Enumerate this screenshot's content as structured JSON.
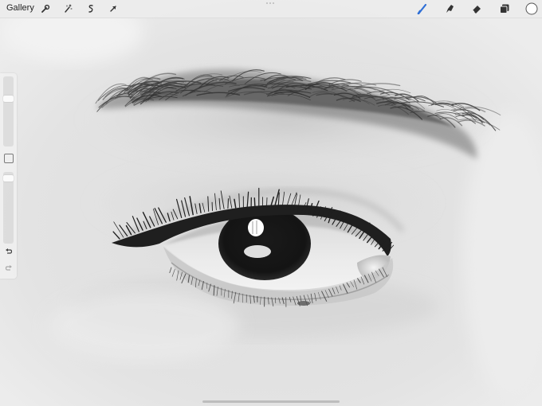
{
  "toolbar": {
    "gallery_label": "Gallery",
    "left_tools": [
      "wrench-icon",
      "magic-wand-icon",
      "selection-icon",
      "transform-arrow-icon"
    ],
    "right_tools": [
      "brush-icon",
      "smudge-icon",
      "eraser-icon",
      "layers-icon",
      "color-swatch"
    ]
  },
  "colors": {
    "accent": "#2f6fd6",
    "active_color": "#ffffff",
    "toolbar_bg": "#ececec"
  },
  "sidebar": {
    "brush_size_level": 0.3,
    "opacity_level": 0.05,
    "controls": [
      "brush-size-slider",
      "modify-button",
      "opacity-slider",
      "undo-button",
      "redo-button"
    ]
  }
}
